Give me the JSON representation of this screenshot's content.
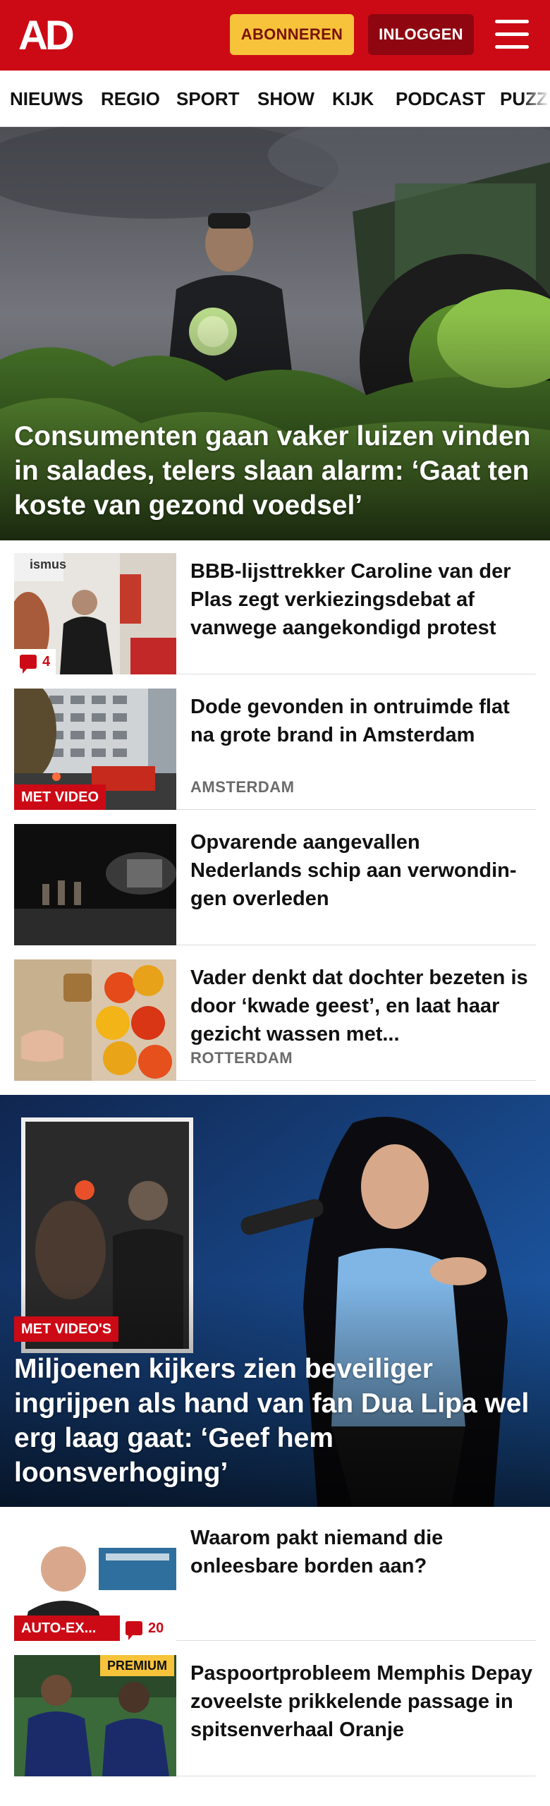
{
  "header": {
    "logo_text": "AD",
    "subscribe_label": "ABONNEREN",
    "login_label": "INLOGGEN",
    "menu_icon": "hamburger-icon",
    "brand_color": "#cc0a16"
  },
  "nav": {
    "items": [
      {
        "label": "NIEUWS"
      },
      {
        "label": "REGIO"
      },
      {
        "label": "SPORT"
      },
      {
        "label": "SHOW"
      },
      {
        "label": "KIJK"
      },
      {
        "label": "PODCAST"
      },
      {
        "label": "PUZZ"
      }
    ]
  },
  "hero": {
    "title": "Consumenten gaan vaker luizen vinden in salades, telers slaan alarm: ‘Gaat ten koste van gezond voedsel’"
  },
  "articles": [
    {
      "title": "BBB-lijsttrekker Caroline van der Plas zegt verkiezingsdebat af vanwege aangekondigd protest",
      "comments": "4",
      "thumb_text": "ismus"
    },
    {
      "title": "Dode gevonden in ontruimde flat na grote brand in Amsterdam",
      "badge": "MET VIDEO",
      "place": "AMSTERDAM"
    },
    {
      "title": "Opvarende aangevallen Nederlands schip aan verwondin­gen overleden"
    },
    {
      "title": "Vader denkt dat dochter bezeten is door ‘kwade geest’, en laat haar gezicht wassen met...",
      "place": "ROTTERDAM"
    }
  ],
  "feature": {
    "badge": "MET VIDEO'S",
    "title": "Miljoenen kijkers zien beveiliger ingrijpen als hand van fan Dua Lipa wel erg laag gaat: ‘Geef hem loonsverhoging’"
  },
  "articles2": [
    {
      "title": "Waarom pakt niemand die onleesbare borden aan?",
      "badge": "AUTO-EX...",
      "comments": "20"
    },
    {
      "title": "Paspoortprobleem Memphis Depay zoveelste prikkelende passage in spitsenverhaal Oranje",
      "premium": "PREMIUM"
    }
  ]
}
